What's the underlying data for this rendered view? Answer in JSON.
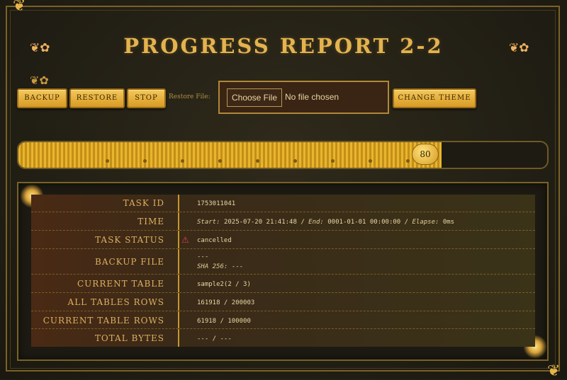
{
  "header": {
    "title": "PROGRESS REPORT 2-2",
    "ornament_left": "❦✿",
    "ornament_right": "❦✿",
    "corner_ornament": "❦"
  },
  "toolbar": {
    "backup_label": "BACKUP",
    "restore_label": "RESTORE",
    "stop_label": "STOP",
    "restore_file_label": "Restore File:",
    "file_button_label": "Choose File",
    "file_status": "No file chosen",
    "change_theme_label": "CHANGE THEME"
  },
  "progress": {
    "value": 80,
    "label": "80"
  },
  "details": {
    "task_id": {
      "label": "TASK ID",
      "value": "1753011041"
    },
    "time": {
      "label": "TIME",
      "start_label": "Start:",
      "start": "2025-07-20 21:41:48",
      "end_label": "End:",
      "end": "0001-01-01 00:00:00",
      "elapse_label": "Elapse:",
      "elapse": "0ms",
      "sep": "/"
    },
    "task_status": {
      "label": "TASK STATUS",
      "value": "cancelled"
    },
    "backup_file": {
      "label": "BACKUP FILE",
      "value": "---",
      "sha_label": "SHA 256:",
      "sha": "---"
    },
    "current_table": {
      "label": "CURRENT TABLE",
      "value": "sample2(2 / 3)"
    },
    "all_tables_rows": {
      "label": "ALL TABLES ROWS",
      "value": "161918 / 200003"
    },
    "current_table_rows": {
      "label": "CURRENT TABLE ROWS",
      "value": "61918 / 100000"
    },
    "total_bytes": {
      "label": "TOTAL BYTES",
      "value": "--- / ---"
    }
  },
  "colors": {
    "accent": "#e4b34e",
    "button": "#e8b040",
    "panel": "#1c1a12",
    "warning": "#e04048"
  },
  "icons": {
    "status": "warning-icon"
  }
}
